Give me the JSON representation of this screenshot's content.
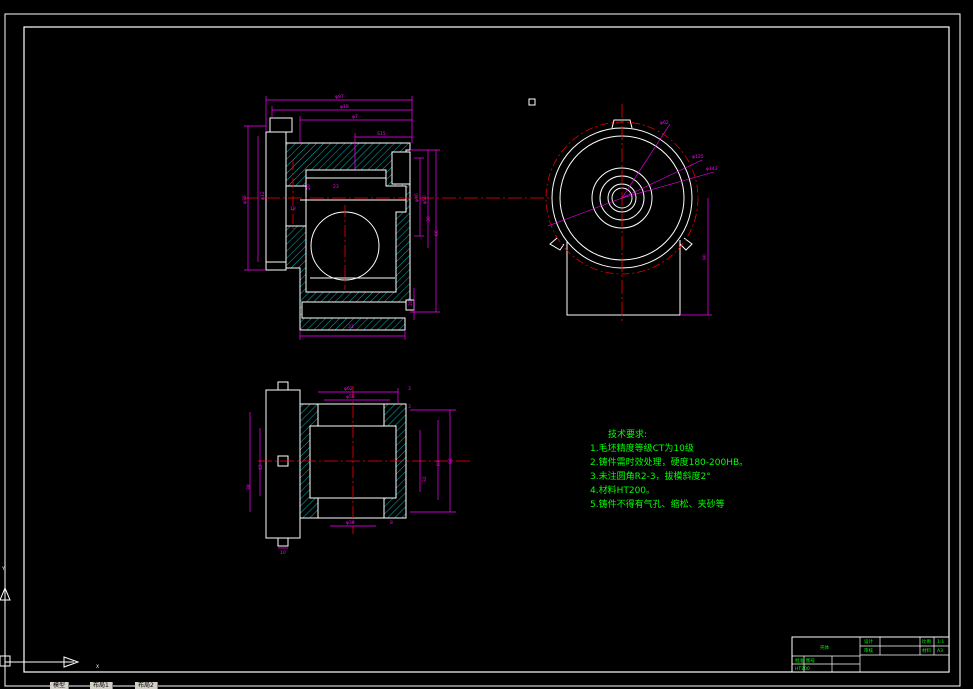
{
  "colors": {
    "background": "#000000",
    "outline": "#ffffff",
    "dimension": "#ff00ff",
    "centerline": "#ff0000",
    "hatch": "#00ffff",
    "notes": "#00ff00"
  },
  "dimensions": {
    "front": {
      "phi97": "φ97",
      "phi18": "φ18",
      "phi7": "φ7",
      "s15": "S15",
      "phi35": "φ35",
      "phi12": "φ12",
      "d18": "18",
      "d23": "23",
      "d20": "20",
      "phi30": "φ30",
      "phi50": "φ50",
      "d30": "30",
      "d66": "66",
      "d20b": "20",
      "d31": "31"
    },
    "side": {
      "phi62": "φ62",
      "phi125": "φ125",
      "phi143": "φ143",
      "d90": "90"
    },
    "bottom": {
      "phi62": "φ62",
      "phi56": "φ56",
      "d3a": "3",
      "d3b": "3",
      "d67": "67",
      "d96": "96",
      "d42": "42",
      "d38": "38",
      "d32": "32",
      "phi38": "φ38",
      "d8": "8",
      "d10": "10"
    }
  },
  "notes": {
    "title": "技术要求:",
    "items": [
      "1.毛坯精度等级CT为10级",
      "2.铸件需时效处理，硬度180-200HB。",
      "3.未注圆角R2-3，拔模斜度2°",
      "4.材料HT200。",
      "5.铸件不得有气孔、缩松、夹砂等"
    ]
  },
  "title_block": {
    "name": "壳体",
    "cells": [
      "设计",
      "审核",
      "批准",
      "比例",
      "1:1",
      "材料",
      "HT200",
      "图号",
      "A3"
    ]
  },
  "ucs": {
    "x": "X",
    "y": "Y"
  },
  "tabs": [
    "模型",
    "布局1",
    "布局2"
  ]
}
